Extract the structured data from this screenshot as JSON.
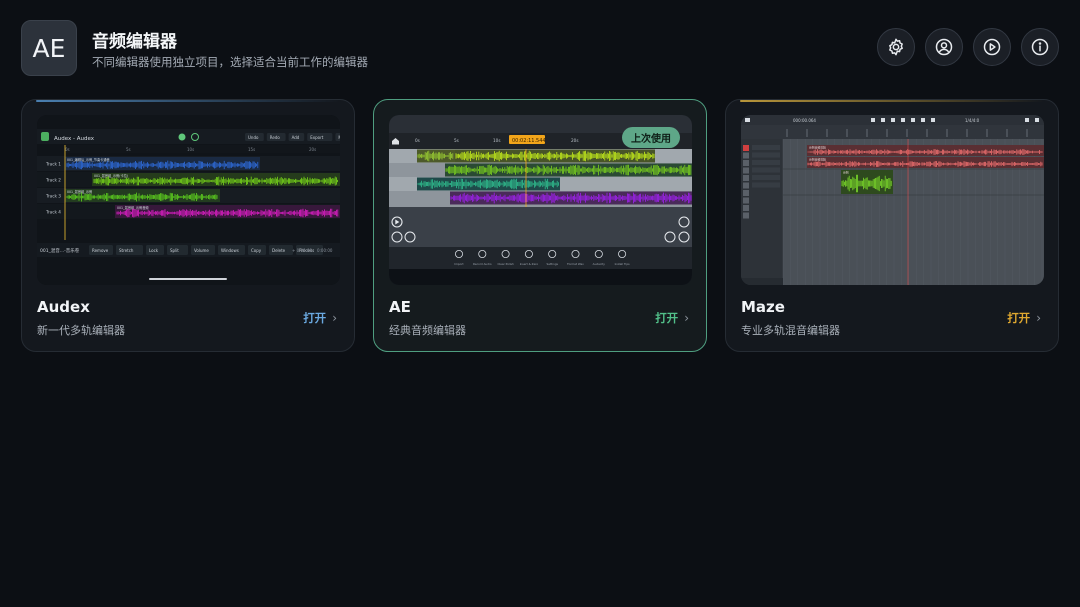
{
  "app": {
    "logo_text": "AE",
    "title": "音频编辑器",
    "subtitle": "不同编辑器使用独立项目，选择适合当前工作的编辑器"
  },
  "toolbar": {
    "icons": [
      "gear-icon",
      "user-circle-icon",
      "play-circle-icon",
      "info-circle-icon"
    ]
  },
  "cards": [
    {
      "name": "Audex",
      "description": "新一代多轨编辑器",
      "open_label": "打开",
      "accent": "#4a7fb0",
      "open_color": "#6aa8e0",
      "preview": {
        "title": "Audex - Audex",
        "buttons": [
          "Undo",
          "Redo",
          "Add",
          "Export",
          "More"
        ],
        "ruler": [
          "0s",
          "5s",
          "10s",
          "15s",
          "20s"
        ],
        "tracks": [
          {
            "label": "Track 1",
            "clip": "001_编辑后_示例_节奏卡通音",
            "color": "#2f6de0"
          },
          {
            "label": "Track 2",
            "clip": "001_混音组_示例(卡拉)",
            "color": "#7adb1a"
          },
          {
            "label": "Track 3",
            "clip": "001_混音组_示例",
            "color": "#5ed41e"
          },
          {
            "label": "Track 4",
            "clip": "001_混音组_示例音频",
            "color": "#e01ec8"
          }
        ],
        "bottom_file": "001_混音...-音乐卷",
        "bottom_buttons": [
          "Remove",
          "Stretch",
          "Lock",
          "Split",
          "Volume",
          "Windows",
          "Copy",
          "Delete",
          "Process"
        ],
        "time_start": "+ 0:00:00",
        "time_end": "0:00:00"
      }
    },
    {
      "name": "AE",
      "description": "经典音频编辑器",
      "open_label": "打开",
      "accent": "#4f9e80",
      "open_color": "#52c08a",
      "badge": "上次使用",
      "preview": {
        "ruler": [
          "0s",
          "5s",
          "10s",
          "15s",
          "20s"
        ],
        "time_display": "00:02:11.544",
        "bottom_tools": [
          "Import",
          "Record Audio",
          "Clear Polish",
          "Insert & Zero",
          "Settings",
          "Format Wav",
          "Audacity",
          "Install Tips"
        ]
      }
    },
    {
      "name": "Maze",
      "description": "专业多轨混音编辑器",
      "open_label": "打开",
      "accent": "#b8963a",
      "open_color": "#e0a830",
      "preview": {
        "time_display": "000:00.064",
        "bar_display": "1/4/4:0",
        "clips": [
          "示例音频剪辑",
          "示例音频剪辑",
          "示例"
        ]
      }
    }
  ]
}
